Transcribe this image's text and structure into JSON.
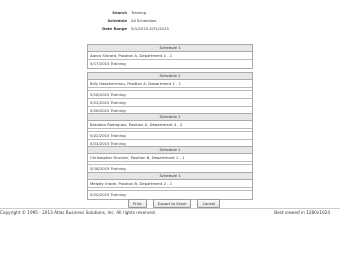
{
  "filters": [
    {
      "label": "Search",
      "value": "Training"
    },
    {
      "label": "Schedule",
      "value": "All Schedules"
    },
    {
      "label": "Date Range",
      "value": "5/1/2015-5/31/2015"
    }
  ],
  "schedules": [
    {
      "header": "Schedule 1",
      "employee": "Aaron Shirard, Position A, Department 1 - 1",
      "dates": [
        "5/17/2015 Training"
      ]
    },
    {
      "header": "Schedule 1",
      "employee": "Billy Hasehorrmau, Position A, Department 1 - 1",
      "dates": [
        "5/16/2015 Training",
        "5/22/2015 Training",
        "5/26/2015 Training"
      ]
    },
    {
      "header": "Schedule 1",
      "employee": "Brandon Rodriguez, Position A, Department 4 - 2",
      "dates": [
        "5/22/2015 Training",
        "5/24/2015 Training"
      ]
    },
    {
      "header": "Schedule 1",
      "employee": "Christopher Drucker, Position B, Department 1 - 1",
      "dates": [
        "5/18/2015 Training"
      ]
    },
    {
      "header": "Schedule 1",
      "employee": "Melody Vrode, Position B, Department 2 - 1",
      "dates": [
        "5/20/2015 Training"
      ]
    }
  ],
  "buttons": {
    "print": "Print",
    "export": "Export to Excel",
    "cancel": "Cancel"
  },
  "footer": {
    "copyright": "Copyright © 1995 - 2013 Atlas Business Solutions, Inc. All rights reserved.",
    "best_viewed": "Best viewed in 1280x1024"
  }
}
